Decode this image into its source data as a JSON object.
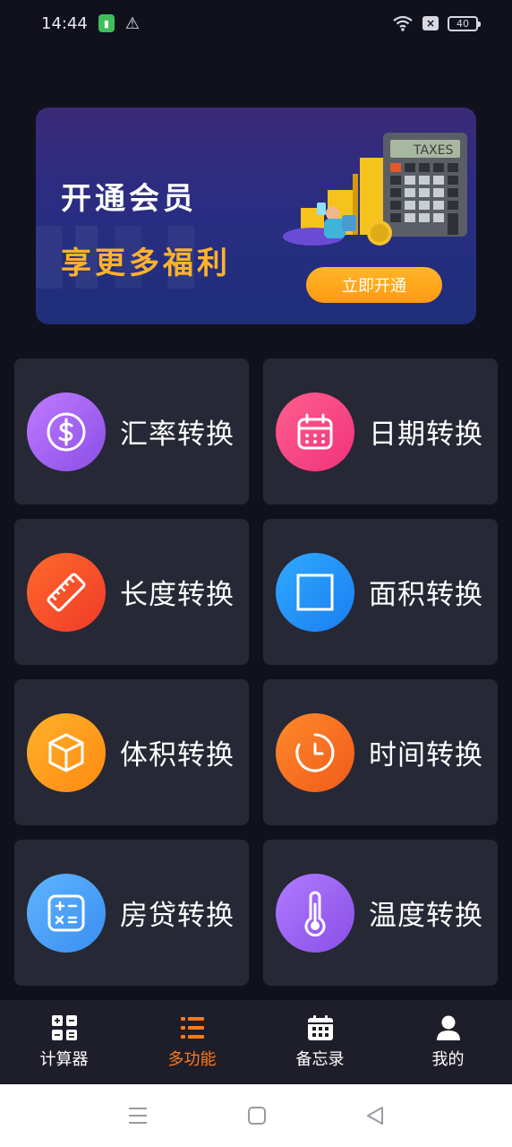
{
  "status_bar": {
    "time": "14:44",
    "battery": "40"
  },
  "banner": {
    "title": "开通会员",
    "subtitle": "享更多福利",
    "button_label": "立即开通",
    "art_label": "TAXES"
  },
  "features": [
    {
      "label": "汇率转换",
      "icon": "dollar-icon"
    },
    {
      "label": "日期转换",
      "icon": "calendar-icon"
    },
    {
      "label": "长度转换",
      "icon": "ruler-icon"
    },
    {
      "label": "面积转换",
      "icon": "square-icon"
    },
    {
      "label": "体积转换",
      "icon": "cube-icon"
    },
    {
      "label": "时间转换",
      "icon": "clock-icon"
    },
    {
      "label": "房贷转换",
      "icon": "calculator-icon"
    },
    {
      "label": "温度转换",
      "icon": "thermometer-icon"
    }
  ],
  "bottom_nav": [
    {
      "label": "计算器",
      "icon": "calculator-grid-icon",
      "active": false
    },
    {
      "label": "多功能",
      "icon": "list-icon",
      "active": true
    },
    {
      "label": "备忘录",
      "icon": "memo-calendar-icon",
      "active": false
    },
    {
      "label": "我的",
      "icon": "user-icon",
      "active": false
    }
  ],
  "colors": {
    "accent": "#ff7a1a",
    "background": "#10111d",
    "card": "#262835",
    "banner_cta": "#ffa51f"
  }
}
